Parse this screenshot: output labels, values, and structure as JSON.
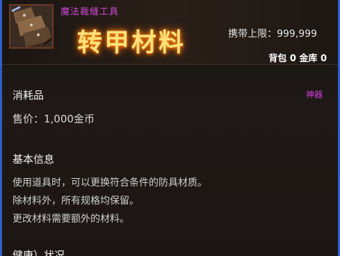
{
  "item": {
    "category": "魔法裁缝工具",
    "name": "转甲材料",
    "carry_limit": "携带上限：999,999",
    "inventory": "背包 0 金库 0",
    "icon": "tool-bundle-icon"
  },
  "details": {
    "type": "消耗品",
    "rarity": "神器",
    "price": "售价：1,000金币",
    "basic_info_title": "基本信息",
    "description": [
      "使用道具时，可以更换符合条件的防具材质。",
      "除材料外，所有规格均保留。",
      "更改材料需要额外的材料。"
    ],
    "health_title": "健康）状况"
  },
  "colors": {
    "border": "#2e5fc9",
    "category": "#d04ad8",
    "name": "#ffe27a",
    "rarity": "#d43fe0"
  }
}
